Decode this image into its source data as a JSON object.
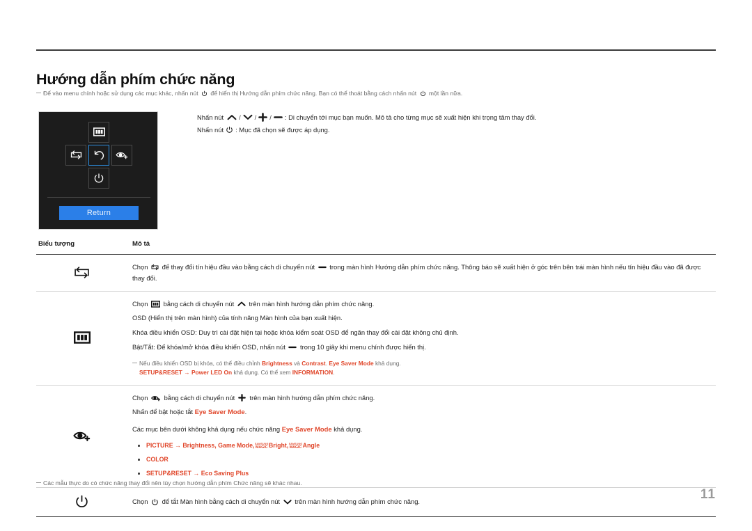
{
  "document": {
    "title": "Hướng dẫn phím chức năng",
    "page_number": "11"
  },
  "top_note": "Để vào menu chính hoặc sử dụng các mục khác, nhấn nút  để hiển thị Hướng dẫn phím chức năng. Bạn có thể thoát bằng cách nhấn nút  một lần nữa.",
  "top_note_parts": {
    "a": "Để vào menu chính hoặc sử dụng các mục khác, nhấn nút",
    "b": "để hiển thị Hướng dẫn phím chức năng. Bạn có thể thoát bằng cách nhấn nút",
    "c": "một lần nữa."
  },
  "osd": {
    "keys": [
      {
        "position": "up",
        "icon": "menu-icon",
        "selected": false
      },
      {
        "position": "left",
        "icon": "source-swap-icon",
        "selected": false
      },
      {
        "position": "center",
        "icon": "return-arrow-icon",
        "selected": true
      },
      {
        "position": "right",
        "icon": "eye-saver-icon",
        "selected": false
      },
      {
        "position": "down",
        "icon": "power-icon",
        "selected": false
      }
    ],
    "return_label": "Return",
    "highlight_color": "#2b7fe8",
    "background_color": "#1c1c1c"
  },
  "intro": {
    "line1_a": "Nhấn nút",
    "line1_keys": [
      "up-arrow-icon",
      "down-arrow-icon",
      "plus-icon",
      "minus-icon"
    ],
    "line1_b": ": Di chuyển tới mục bạn muốn. Mô tả cho từng mục sẽ xuất hiện khi trọng tâm thay đổi.",
    "line2_a": "Nhấn nút",
    "line2_key": "power-icon",
    "line2_b": ": Mục đã chọn sẽ được áp dụng."
  },
  "table": {
    "headers": {
      "icon": "Biểu tượng",
      "description": "Mô tả"
    },
    "rows": [
      {
        "icon": "source-swap-icon",
        "lines": [
          {
            "a": "Chọn",
            "icon1": "source-swap-icon",
            "b": "để thay đổi tín hiệu đầu vào bằng cách di chuyển nút",
            "icon2": "minus-icon",
            "c": "trong màn hình Hướng dẫn phím chức năng. Thông báo sẽ xuất hiện ở góc trên bên trái màn hình nếu tín hiệu đầu vào đã được thay đổi."
          }
        ]
      },
      {
        "icon": "menu-icon",
        "lines": [
          {
            "a": "Chọn",
            "icon1": "menu-icon",
            "b": "bằng cách di chuyển nút",
            "icon2": "up-arrow-icon",
            "c": "trên màn hình hướng dẫn phím chức năng."
          },
          {
            "a": "OSD (Hiển thị trên màn hình) của tính năng Màn hình của bạn xuất hiện."
          },
          {
            "a": "Khóa điều khiển OSD: Duy trì cài đặt hiện tại hoặc khóa kiểm soát OSD để ngăn thay đổi cài đặt không chủ định."
          },
          {
            "a": "Bật/Tắt: Để khóa/mở khóa điều khiển OSD, nhấn nút",
            "icon2": "minus-icon",
            "c": "trong 10 giây khi menu chính được hiển thị."
          }
        ],
        "sub_note": {
          "l1_a": "Nếu điều khiển OSD bị khóa, có thể điều chỉnh",
          "l1_k1": "Brightness",
          "l1_b": "và",
          "l1_k2": "Contrast",
          "l1_c": ".",
          "l1_k3": "Eye Saver Mode",
          "l1_d": "khả dụng.",
          "l2_k1": "SETUP&RESET",
          "l2_arrow": "→",
          "l2_k2": "Power LED On",
          "l2_b": "khả dụng. Có thể xem",
          "l2_k3": "INFORMATION",
          "l2_c": "."
        }
      },
      {
        "icon": "eye-saver-icon",
        "lines": [
          {
            "a": "Chọn",
            "icon1": "eye-saver-icon",
            "b": "bằng cách di chuyển nút",
            "icon2": "plus-icon",
            "c": "trên màn hình hướng dẫn phím chức năng."
          },
          {
            "a": "Nhấn để bật hoặc tắt",
            "k1": "Eye Saver Mode",
            "c": "."
          },
          {
            "a": "Các mục bên dưới không khả dụng nếu chức năng",
            "k1": "Eye Saver Mode",
            "c": "khả dụng."
          }
        ],
        "bullets": [
          {
            "pre": "PICTURE",
            "arrow": "→",
            "mid": "Brightness, Game Mode,",
            "magic1_top": "SAMSUNG",
            "magic1_bottom": "MAGIC",
            "magic1_word": "Bright,",
            "magic2_top": "SAMSUNG",
            "magic2_bottom": "MAGIC",
            "magic2_word": "Angle"
          },
          {
            "pre": "COLOR"
          },
          {
            "pre": "SETUP&RESET",
            "arrow": "→",
            "mid": "Eco Saving Plus"
          }
        ]
      },
      {
        "icon": "power-icon",
        "lines": [
          {
            "a": "Chọn",
            "icon1": "power-icon",
            "b": "để tắt Màn hình bằng cách di chuyển nút",
            "icon2": "down-arrow-icon",
            "c": "trên màn hình hướng dẫn phím chức năng."
          }
        ]
      }
    ]
  },
  "bottom_note": "Các mẫu thực do có chức năng thay đổi nên tùy chọn hướng dẫn phím Chức năng sẽ khác nhau.",
  "colors": {
    "accent": "#e0462a",
    "osd_blue": "#2b7fe8",
    "page_number": "#9a9a9a",
    "note_text": "#6c6c6c"
  }
}
